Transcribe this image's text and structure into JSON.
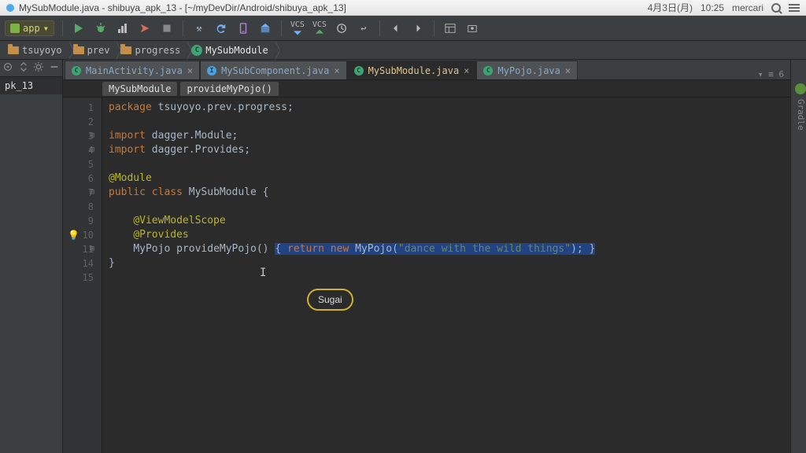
{
  "window": {
    "title": "MySubModule.java - shibuya_apk_13 - [~/myDevDir/Android/shibuya_apk_13]",
    "date_label": "4月3日(月)",
    "time_label": "10:25",
    "brand_label": "mercari"
  },
  "toolbar": {
    "module_label": "app",
    "vcs_down": "VCS",
    "vcs_up": "VCS"
  },
  "breadcrumbs": [
    {
      "kind": "folder",
      "label": "tsuyoyo"
    },
    {
      "kind": "folder",
      "label": "prev"
    },
    {
      "kind": "folder",
      "label": "progress"
    },
    {
      "kind": "class",
      "label": "MySubModule"
    }
  ],
  "sidebar": {
    "project_label": "pk_13"
  },
  "tabs": {
    "items": [
      {
        "label": "MainActivity.java",
        "icon": "class",
        "active": false
      },
      {
        "label": "MySubComponent.java",
        "icon": "interface",
        "active": false
      },
      {
        "label": "MySubModule.java",
        "icon": "class",
        "active": true
      },
      {
        "label": "MyPojo.java",
        "icon": "class",
        "active": false
      }
    ],
    "overflow_label": "▾ ≡ 6"
  },
  "editor_crumbs": {
    "class_label": "MySubModule",
    "method_label": "provideMyPojo()"
  },
  "code": {
    "line_numbers": [
      "1",
      "2",
      "3",
      "4",
      "5",
      "6",
      "7",
      "8",
      "9",
      "10",
      "11",
      "14",
      "15"
    ],
    "package_kw": "package",
    "package_path": "tsuyoyo.prev.progress;",
    "import_kw": "import",
    "import1": "dagger.Module;",
    "import2": "dagger.Provides;",
    "anno_module": "@Module",
    "public_kw": "public",
    "class_kw": "class",
    "class_name": "MySubModule",
    "anno_vms": "@ViewModelScope",
    "anno_provides": "@Provides",
    "ret_type": "MyPojo",
    "method_sig": "provideMyPojo()",
    "body_a": "{ ",
    "return_kw": "return",
    "new_kw": "new",
    "ctor": "MyPojo",
    "string_lit": "\"dance with the wild things\"",
    "body_b": "); }"
  },
  "bubble": {
    "label": "Sugai"
  },
  "right_panel": {
    "label": "Gradle"
  }
}
